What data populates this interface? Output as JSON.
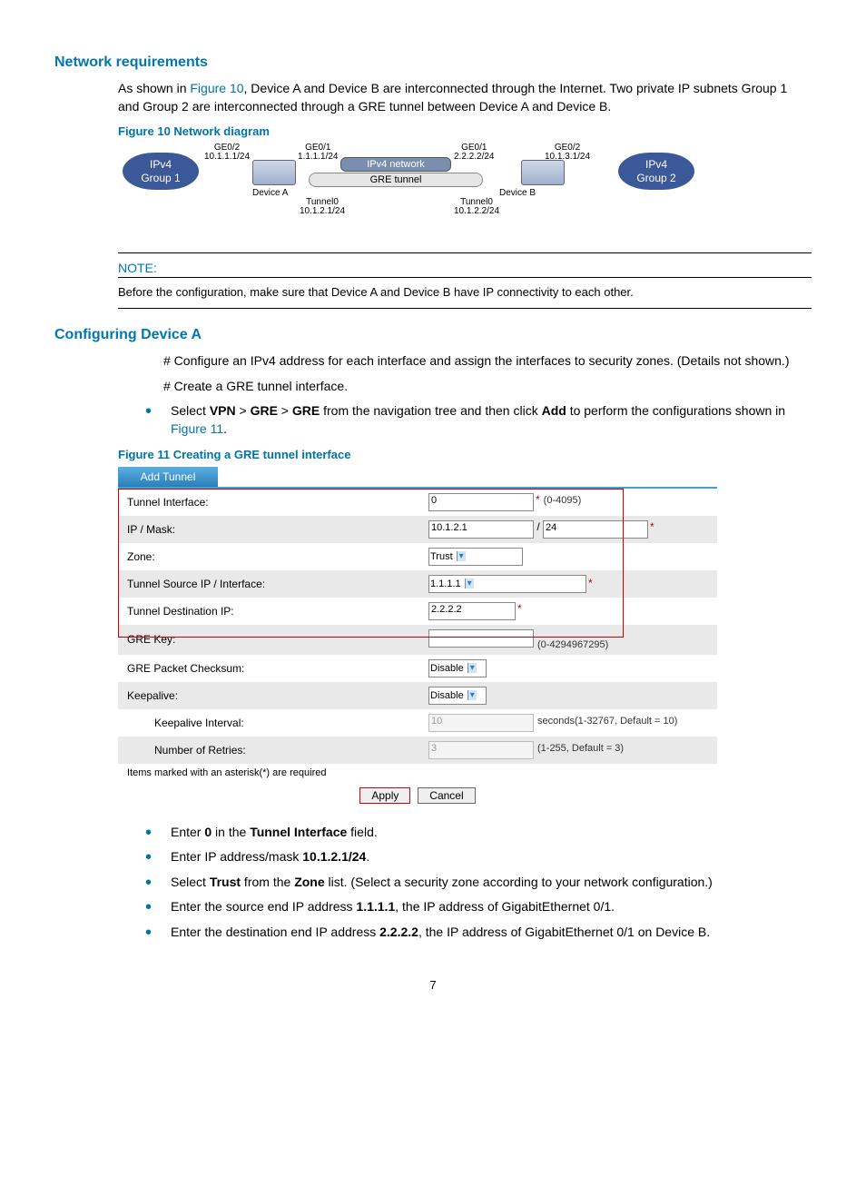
{
  "sections": {
    "netreq_title": "Network requirements",
    "netreq_p1a": "As shown in ",
    "netreq_link1": "Figure 10",
    "netreq_p1b": ", Device A and Device B are interconnected through the Internet. Two private IP subnets Group 1 and Group 2 are interconnected through a GRE tunnel between Device A and Device B.",
    "fig10_caption": "Figure 10 Network diagram",
    "diagram": {
      "group1_a": "IPv4",
      "group1_b": "Group 1",
      "group2_a": "IPv4",
      "group2_b": "Group 2",
      "ipv4net": "IPv4 network",
      "gre": "GRE tunnel",
      "ge02_l": "GE0/2",
      "addr_ge02_l": "10.1.1.1/24",
      "ge01_l": "GE0/1",
      "addr_ge01_l": "1.1.1.1/24",
      "ge01_r": "GE0/1",
      "addr_ge01_r": "2.2.2.2/24",
      "ge02_r": "GE0/2",
      "addr_ge02_r": "10.1.3.1/24",
      "devA": "Device A",
      "devB": "Device B",
      "tun0_l": "Tunnel0",
      "tun0_l_ip": "10.1.2.1/24",
      "tun0_r": "Tunnel0",
      "tun0_r_ip": "10.1.2.2/24"
    },
    "note_label": "NOTE:",
    "note_text": "Before the configuration, make sure that Device A and Device B have IP connectivity to each other.",
    "cfgA_title": "Configuring Device A",
    "cfgA_step1": "# Configure an IPv4 address for each interface and assign the interfaces to security zones. (Details not shown.)",
    "cfgA_step2": "# Create a GRE tunnel interface.",
    "bullet_nav_a": "Select ",
    "bullet_nav_vpn": "VPN",
    "bullet_nav_gt": " > ",
    "bullet_nav_gre": "GRE",
    "bullet_nav_b": " from the navigation tree and then click ",
    "bullet_nav_add": "Add",
    "bullet_nav_c": " to perform the configurations shown in ",
    "bullet_nav_link": "Figure 11",
    "bullet_nav_d": ".",
    "fig11_caption": "Figure 11 Creating a GRE tunnel interface",
    "b2a": "Enter ",
    "b2b": "0",
    "b2c": " in the ",
    "b2d": "Tunnel Interface",
    "b2e": " field.",
    "b3a": "Enter IP address/mask ",
    "b3b": "10.1.2.1/24",
    "b3c": ".",
    "b4a": "Select ",
    "b4b": "Trust",
    "b4c": " from the ",
    "b4d": "Zone",
    "b4e": " list. (Select a security zone according to your network configuration.)",
    "b5a": "Enter the source end IP address ",
    "b5b": "1.1.1.1",
    "b5c": ", the IP address of GigabitEthernet 0/1.",
    "b6a": "Enter the destination end IP address ",
    "b6b": "2.2.2.2",
    "b6c": ", the IP address of GigabitEthernet 0/1 on Device B."
  },
  "form": {
    "tab": "Add Tunnel",
    "rows": {
      "tunnel_if_lbl": "Tunnel Interface:",
      "tunnel_if_val": "0",
      "tunnel_if_hint": "(0-4095)",
      "ipmask_lbl": "IP / Mask:",
      "ipmask_ip": "10.1.2.1",
      "ipmask_sep": "/",
      "ipmask_mask": "24",
      "zone_lbl": "Zone:",
      "zone_val": "Trust",
      "src_lbl": "Tunnel Source IP / Interface:",
      "src_val": "1.1.1.1",
      "dst_lbl": "Tunnel Destination IP:",
      "dst_val": "2.2.2.2",
      "grekey_lbl": "GRE Key:",
      "grekey_val": "",
      "grekey_hint": "(0-4294967295)",
      "cksum_lbl": "GRE Packet Checksum:",
      "cksum_val": "Disable",
      "keep_lbl": "Keepalive:",
      "keep_val": "Disable",
      "kint_lbl": "Keepalive Interval:",
      "kint_val": "10",
      "kint_hint": "seconds(1-32767, Default = 10)",
      "kret_lbl": "Number of Retries:",
      "kret_val": "3",
      "kret_hint": "(1-255, Default = 3)"
    },
    "footnote": "Items marked with an asterisk(*) are required",
    "apply": "Apply",
    "cancel": "Cancel"
  },
  "page": "7"
}
